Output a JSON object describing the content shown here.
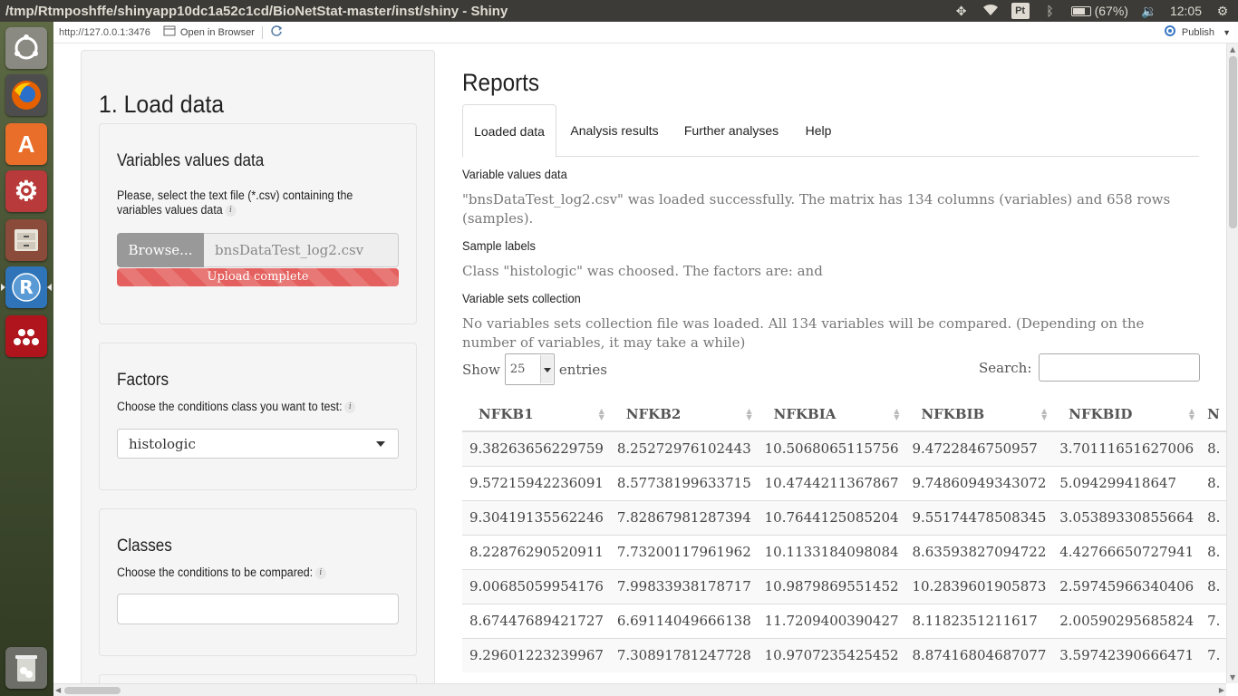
{
  "window": {
    "title": "/tmp/Rtmposhffe/shinyapp10dc1a52c1cd/BioNetStat-master/inst/shiny - Shiny",
    "battery": "(67%)",
    "clock": "12:05",
    "tray_pt": "Pt"
  },
  "viewer": {
    "url": "http://127.0.0.1:3476",
    "open_in_browser": "Open in Browser",
    "publish": "Publish"
  },
  "sidebar": {
    "title": "1. Load data",
    "variables": {
      "heading": "Variables values data",
      "label": "Please, select the text file (*.csv) containing the variables values data",
      "browse": "Browse...",
      "file_name": "bnsDataTest_log2.csv",
      "progress": "Upload complete",
      "progress_percent": 100
    },
    "factors": {
      "heading": "Factors",
      "label": "Choose the conditions class you want to test:",
      "selected": "histologic"
    },
    "classes": {
      "heading": "Classes",
      "label": "Choose the conditions to be compared:",
      "value": ""
    }
  },
  "main": {
    "title": "Reports",
    "tabs": [
      {
        "label": "Loaded data",
        "active": true
      },
      {
        "label": "Analysis results",
        "active": false
      },
      {
        "label": "Further analyses",
        "active": false
      },
      {
        "label": "Help",
        "active": false
      }
    ],
    "sections": {
      "variable_values_title": "Variable values data",
      "variable_values_text": "\"bnsDataTest_log2.csv\" was loaded successfully. The matrix has 134 columns (variables) and 658 rows (samples).",
      "sample_labels_title": "Sample labels",
      "sample_labels_text": "Class \"histologic\" was choosed. The factors are: and",
      "variable_sets_title": "Variable sets collection",
      "variable_sets_text": "No variables sets collection file was loaded. All 134 variables will be compared. (Depending on the number of variables, it may take a while)"
    },
    "table": {
      "show_label": "Show",
      "page_length": "25",
      "entries_label": "entries",
      "search_label": "Search:",
      "search_value": "",
      "columns": [
        "NFKB1",
        "NFKB2",
        "NFKBIA",
        "NFKBIB",
        "NFKBID",
        "N"
      ],
      "rows": [
        [
          "9.38263656229759",
          "8.25272976102443",
          "10.5068065115756",
          "9.4722846750957",
          "3.70111651627006",
          "8."
        ],
        [
          "9.57215942236091",
          "8.57738199633715",
          "10.4744211367867",
          "9.74860949343072",
          "5.094299418647",
          "8."
        ],
        [
          "9.30419135562246",
          "7.82867981287394",
          "10.7644125085204",
          "9.55174478508345",
          "3.05389330855664",
          "8."
        ],
        [
          "8.22876290520911",
          "7.73200117961962",
          "10.1133184098084",
          "8.63593827094722",
          "4.42766650727941",
          "8."
        ],
        [
          "9.00685059954176",
          "7.99833938178717",
          "10.9879869551452",
          "10.2839601905873",
          "2.59745966340406",
          "8."
        ],
        [
          "8.67447689421727",
          "6.69114049666138",
          "11.7209400390427",
          "8.1182351211617",
          "2.00590295685824",
          "7."
        ],
        [
          "9.29601223239967",
          "7.30891781247728",
          "10.9707235425452",
          "8.87416804687077",
          "3.59742390666471",
          "7."
        ]
      ]
    }
  },
  "colors": {
    "system_bar": "#3c3b37",
    "progress": "#e4605e",
    "well_bg": "#f5f5f5",
    "browse_btn": "#999999"
  },
  "icons": {
    "launcher": [
      "ubuntu-dash-icon",
      "firefox-icon",
      "software-center-icon",
      "system-settings-icon",
      "file-cabinet-icon",
      "rstudio-icon",
      "mendeley-icon",
      "trash-icon"
    ]
  }
}
